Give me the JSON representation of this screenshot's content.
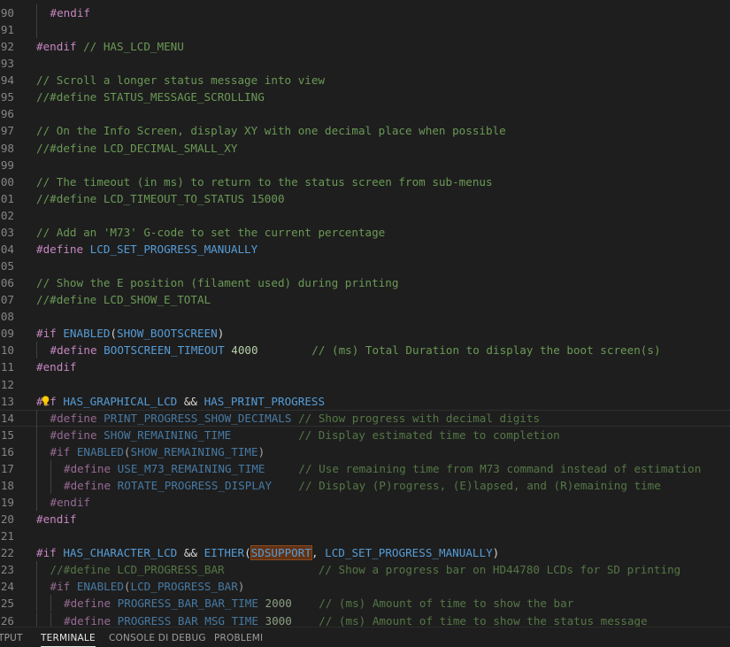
{
  "editor": {
    "lines": [
      {
        "num": "90",
        "indent": 1,
        "tokens": [
          {
            "c": "pp",
            "t": "#endif"
          }
        ]
      },
      {
        "num": "91",
        "indent": 1,
        "tokens": []
      },
      {
        "num": "92",
        "indent": 0,
        "tokens": [
          {
            "c": "pp",
            "t": "#endif"
          },
          {
            "c": "cm",
            "t": " // HAS_LCD_MENU"
          }
        ]
      },
      {
        "num": "93",
        "indent": 0,
        "tokens": []
      },
      {
        "num": "94",
        "indent": 0,
        "tokens": [
          {
            "c": "cm",
            "t": "// Scroll a longer status message into view"
          }
        ]
      },
      {
        "num": "95",
        "indent": 0,
        "tokens": [
          {
            "c": "cm",
            "t": "//#define STATUS_MESSAGE_SCROLLING"
          }
        ]
      },
      {
        "num": "96",
        "indent": 0,
        "tokens": []
      },
      {
        "num": "97",
        "indent": 0,
        "tokens": [
          {
            "c": "cm",
            "t": "// On the Info Screen, display XY with one decimal place when possible"
          }
        ]
      },
      {
        "num": "98",
        "indent": 0,
        "tokens": [
          {
            "c": "cm",
            "t": "//#define LCD_DECIMAL_SMALL_XY"
          }
        ]
      },
      {
        "num": "99",
        "indent": 0,
        "tokens": []
      },
      {
        "num": "00",
        "indent": 0,
        "tokens": [
          {
            "c": "cm",
            "t": "// The timeout (in ms) to return to the status screen from sub-menus"
          }
        ]
      },
      {
        "num": "01",
        "indent": 0,
        "tokens": [
          {
            "c": "cm",
            "t": "//#define LCD_TIMEOUT_TO_STATUS 15000"
          }
        ]
      },
      {
        "num": "02",
        "indent": 0,
        "tokens": []
      },
      {
        "num": "03",
        "indent": 0,
        "tokens": [
          {
            "c": "cm",
            "t": "// Add an 'M73' G-code to set the current percentage"
          }
        ]
      },
      {
        "num": "04",
        "indent": 0,
        "tokens": [
          {
            "c": "pp",
            "t": "#define"
          },
          {
            "c": "pl",
            "t": " "
          },
          {
            "c": "m",
            "t": "LCD_SET_PROGRESS_MANUALLY"
          }
        ]
      },
      {
        "num": "05",
        "indent": 0,
        "tokens": []
      },
      {
        "num": "06",
        "indent": 0,
        "tokens": [
          {
            "c": "cm",
            "t": "// Show the E position (filament used) during printing"
          }
        ]
      },
      {
        "num": "07",
        "indent": 0,
        "tokens": [
          {
            "c": "cm",
            "t": "//#define LCD_SHOW_E_TOTAL"
          }
        ]
      },
      {
        "num": "08",
        "indent": 0,
        "tokens": []
      },
      {
        "num": "09",
        "indent": 0,
        "tokens": [
          {
            "c": "pp",
            "t": "#if"
          },
          {
            "c": "pl",
            "t": " "
          },
          {
            "c": "m",
            "t": "ENABLED"
          },
          {
            "c": "pl",
            "t": "("
          },
          {
            "c": "m",
            "t": "SHOW_BOOTSCREEN"
          },
          {
            "c": "pl",
            "t": ")"
          }
        ]
      },
      {
        "num": "10",
        "indent": 1,
        "tokens": [
          {
            "c": "pp",
            "t": "#define"
          },
          {
            "c": "pl",
            "t": " "
          },
          {
            "c": "m",
            "t": "BOOTSCREEN_TIMEOUT"
          },
          {
            "c": "pl",
            "t": " "
          },
          {
            "c": "n",
            "t": "4000"
          },
          {
            "c": "pl",
            "t": "        "
          },
          {
            "c": "cm",
            "t": "// (ms) Total Duration to display the boot screen(s)"
          }
        ]
      },
      {
        "num": "11",
        "indent": 0,
        "tokens": [
          {
            "c": "pp",
            "t": "#endif"
          }
        ]
      },
      {
        "num": "12",
        "indent": 0,
        "tokens": []
      },
      {
        "num": "13",
        "indent": 0,
        "bulb": true,
        "tokens": [
          {
            "c": "pp",
            "t": "#if"
          },
          {
            "c": "pl",
            "t": " "
          },
          {
            "c": "m",
            "t": "HAS_GRAPHICAL_LCD"
          },
          {
            "c": "pl",
            "t": " && "
          },
          {
            "c": "m",
            "t": "HAS_PRINT_PROGRESS"
          }
        ]
      },
      {
        "num": "14",
        "indent": 1,
        "dim": true,
        "active": true,
        "tokens": [
          {
            "c": "pp",
            "t": "#define"
          },
          {
            "c": "pl",
            "t": " "
          },
          {
            "c": "m",
            "t": "PRINT_PROGRESS_SHOW_DECIMALS"
          },
          {
            "c": "pl",
            "t": " "
          },
          {
            "c": "cm",
            "t": "// Show progress with decimal digits"
          }
        ]
      },
      {
        "num": "15",
        "indent": 1,
        "dim": true,
        "tokens": [
          {
            "c": "pp",
            "t": "#define"
          },
          {
            "c": "pl",
            "t": " "
          },
          {
            "c": "m",
            "t": "SHOW_REMAINING_TIME"
          },
          {
            "c": "pl",
            "t": "          "
          },
          {
            "c": "cm",
            "t": "// Display estimated time to completion"
          }
        ]
      },
      {
        "num": "16",
        "indent": 1,
        "dim": true,
        "tokens": [
          {
            "c": "pp",
            "t": "#if"
          },
          {
            "c": "pl",
            "t": " "
          },
          {
            "c": "m",
            "t": "ENABLED"
          },
          {
            "c": "pl",
            "t": "("
          },
          {
            "c": "m",
            "t": "SHOW_REMAINING_TIME"
          },
          {
            "c": "pl",
            "t": ")"
          }
        ]
      },
      {
        "num": "17",
        "indent": 2,
        "dim": true,
        "tokens": [
          {
            "c": "pp",
            "t": "#define"
          },
          {
            "c": "pl",
            "t": " "
          },
          {
            "c": "m",
            "t": "USE_M73_REMAINING_TIME"
          },
          {
            "c": "pl",
            "t": "     "
          },
          {
            "c": "cm",
            "t": "// Use remaining time from M73 command instead of estimation"
          }
        ]
      },
      {
        "num": "18",
        "indent": 2,
        "dim": true,
        "tokens": [
          {
            "c": "pp",
            "t": "#define"
          },
          {
            "c": "pl",
            "t": " "
          },
          {
            "c": "m",
            "t": "ROTATE_PROGRESS_DISPLAY"
          },
          {
            "c": "pl",
            "t": "    "
          },
          {
            "c": "cm",
            "t": "// Display (P)rogress, (E)lapsed, and (R)emaining time"
          }
        ]
      },
      {
        "num": "19",
        "indent": 1,
        "dim": true,
        "tokens": [
          {
            "c": "pp",
            "t": "#endif"
          }
        ]
      },
      {
        "num": "20",
        "indent": 0,
        "tokens": [
          {
            "c": "pp",
            "t": "#endif"
          }
        ]
      },
      {
        "num": "21",
        "indent": 0,
        "tokens": []
      },
      {
        "num": "22",
        "indent": 0,
        "tokens": [
          {
            "c": "pp",
            "t": "#if"
          },
          {
            "c": "pl",
            "t": " "
          },
          {
            "c": "m",
            "t": "HAS_CHARACTER_LCD"
          },
          {
            "c": "pl",
            "t": " && "
          },
          {
            "c": "m",
            "t": "EITHER"
          },
          {
            "c": "pl",
            "t": "("
          },
          {
            "c": "hl",
            "t": "SDSUPPORT"
          },
          {
            "c": "pl",
            "t": ", "
          },
          {
            "c": "m",
            "t": "LCD_SET_PROGRESS_MANUALLY"
          },
          {
            "c": "pl",
            "t": ")"
          }
        ]
      },
      {
        "num": "23",
        "indent": 1,
        "dim": true,
        "tokens": [
          {
            "c": "cm",
            "t": "//#define LCD_PROGRESS_BAR"
          },
          {
            "c": "pl",
            "t": "              "
          },
          {
            "c": "cm",
            "t": "// Show a progress bar on HD44780 LCDs for SD printing"
          }
        ]
      },
      {
        "num": "24",
        "indent": 1,
        "dim": true,
        "tokens": [
          {
            "c": "pp",
            "t": "#if"
          },
          {
            "c": "pl",
            "t": " "
          },
          {
            "c": "m",
            "t": "ENABLED"
          },
          {
            "c": "pl",
            "t": "("
          },
          {
            "c": "m",
            "t": "LCD_PROGRESS_BAR"
          },
          {
            "c": "pl",
            "t": ")"
          }
        ]
      },
      {
        "num": "25",
        "indent": 2,
        "dim": true,
        "tokens": [
          {
            "c": "pp",
            "t": "#define"
          },
          {
            "c": "pl",
            "t": " "
          },
          {
            "c": "m",
            "t": "PROGRESS_BAR_BAR_TIME"
          },
          {
            "c": "pl",
            "t": " "
          },
          {
            "c": "n",
            "t": "2000"
          },
          {
            "c": "pl",
            "t": "    "
          },
          {
            "c": "cm",
            "t": "// (ms) Amount of time to show the bar"
          }
        ]
      },
      {
        "num": "26",
        "indent": 2,
        "dim": true,
        "tokens": [
          {
            "c": "pp",
            "t": "#define"
          },
          {
            "c": "pl",
            "t": " "
          },
          {
            "c": "m",
            "t": "PROGRESS_BAR_MSG_TIME"
          },
          {
            "c": "pl",
            "t": " "
          },
          {
            "c": "n",
            "t": "3000"
          },
          {
            "c": "pl",
            "t": "    "
          },
          {
            "c": "cm",
            "t": "// (ms) Amount of time to show the status message"
          }
        ]
      }
    ]
  },
  "panel": {
    "tabs": [
      {
        "label": "TPUT",
        "active": false
      },
      {
        "label": "TERMINALE",
        "active": true
      },
      {
        "label": "CONSOLE DI DEBUG",
        "active": false
      },
      {
        "label": "PROBLEMI",
        "active": false
      }
    ]
  },
  "colors": {
    "background": "#1e1e1e",
    "preprocessor": "#c586c0",
    "comment": "#6a9955",
    "macro": "#569cd6",
    "number": "#b5cea8",
    "line_number": "#858585"
  },
  "icons": {
    "lightbulb": "lightbulb-icon"
  }
}
